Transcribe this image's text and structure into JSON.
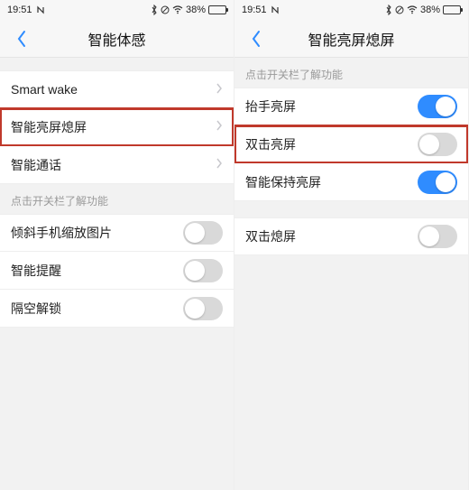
{
  "status": {
    "time": "19:51",
    "battery_pct": "38%",
    "battery_fill_pct": 38,
    "bt_icon": "bluetooth",
    "dnd_icon": "do-not-disturb",
    "wifi_icon": "wifi"
  },
  "left": {
    "title": "智能体感",
    "rows": [
      {
        "label": "Smart wake",
        "type": "nav"
      },
      {
        "label": "智能亮屏熄屏",
        "type": "nav",
        "highlight": true
      },
      {
        "label": "智能通话",
        "type": "nav"
      }
    ],
    "hint": "点击开关栏了解功能",
    "toggles": [
      {
        "label": "倾斜手机缩放图片",
        "on": false
      },
      {
        "label": "智能提醒",
        "on": false
      },
      {
        "label": "隔空解锁",
        "on": false
      }
    ]
  },
  "right": {
    "title": "智能亮屏熄屏",
    "hint": "点击开关栏了解功能",
    "group1": [
      {
        "label": "抬手亮屏",
        "on": true
      },
      {
        "label": "双击亮屏",
        "on": false,
        "highlight": true
      },
      {
        "label": "智能保持亮屏",
        "on": true
      }
    ],
    "group2": [
      {
        "label": "双击熄屏",
        "on": false
      }
    ]
  }
}
